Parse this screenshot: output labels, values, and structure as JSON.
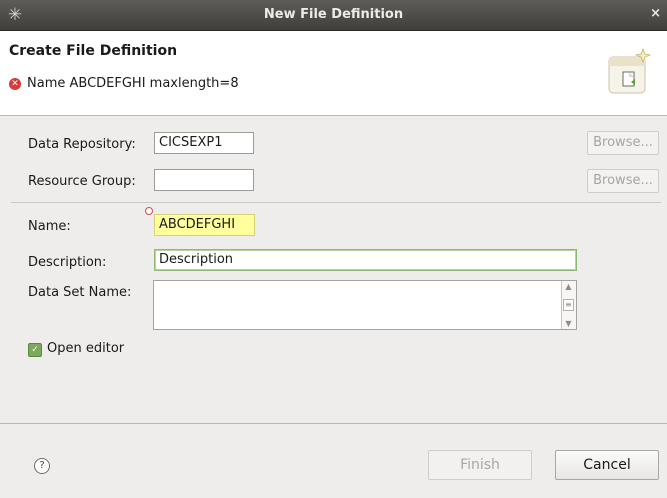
{
  "window": {
    "title": "New File Definition",
    "close_glyph": "×"
  },
  "header": {
    "title": "Create File Definition",
    "message": "Name ABCDEFGHI maxlength=8",
    "message_icon": "error-icon",
    "wizard_icon": "new-file-wizard-icon"
  },
  "form": {
    "data_repository": {
      "label": "Data Repository:",
      "value": "CICSEXP1",
      "browse_label": "Browse..."
    },
    "resource_group": {
      "label": "Resource Group:",
      "value": "",
      "browse_label": "Browse..."
    },
    "name": {
      "label": "Name:",
      "value": "ABCDEFGHI"
    },
    "description": {
      "label": "Description:",
      "value": "Description"
    },
    "data_set_name": {
      "label": "Data Set Name:",
      "value": ""
    },
    "open_editor": {
      "label": "Open editor",
      "checked": true
    }
  },
  "footer": {
    "help_glyph": "?",
    "finish_label": "Finish",
    "cancel_label": "Cancel"
  }
}
